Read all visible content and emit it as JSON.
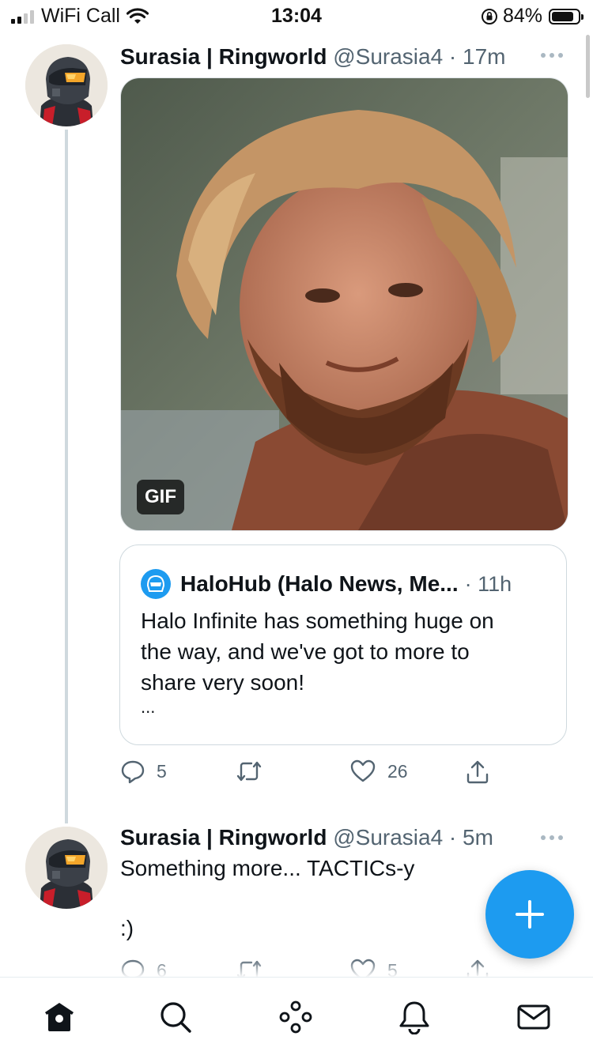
{
  "status_bar": {
    "carrier": "WiFi Call",
    "time": "13:04",
    "battery": "84%",
    "battery_level": 0.84
  },
  "tweet1": {
    "display_name": "Surasia | Ringworld",
    "meta": "@Surasia4 · 17m",
    "avatar_icon": "halo-spartan-avatar",
    "media": {
      "badge": "GIF",
      "icon": "animated-gif-image"
    },
    "quote": {
      "avatar_icon": "halohub-helmet-logo",
      "name": "HaloHub (Halo News, Me...",
      "meta": "· 11h",
      "text": "Halo Infinite has something huge on\nthe way, and we've got to more to\nshare very soon!",
      "ellipsis": "..."
    },
    "actions": {
      "replies": "5",
      "retweets": "",
      "likes": "26"
    }
  },
  "tweet2": {
    "display_name": "Surasia | Ringworld",
    "meta": "@Surasia4 · 5m",
    "avatar_icon": "halo-spartan-avatar",
    "text": "Something more... TACTICs-y\n\n:)",
    "actions": {
      "replies": "6",
      "retweets": "",
      "likes": "5"
    }
  },
  "fab": {
    "icon": "plus-icon",
    "color": "#1d9bf0"
  },
  "tab_bar": {
    "items": [
      {
        "icon": "home-icon"
      },
      {
        "icon": "search-icon"
      },
      {
        "icon": "spaces-icon"
      },
      {
        "icon": "notifications-bell-icon"
      },
      {
        "icon": "messages-envelope-icon"
      }
    ]
  },
  "colors": {
    "accent": "#1d9bf0",
    "text": "#0f1419",
    "secondary": "#536471",
    "border": "#cfd9de"
  }
}
